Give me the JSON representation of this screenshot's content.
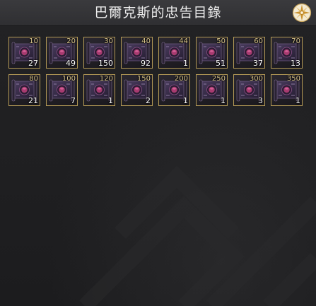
{
  "window": {
    "title": "巴爾克斯的忠告目錄",
    "emblem_icon": "compass-star-icon"
  },
  "colors": {
    "slot_border": "#b49a56",
    "tier_text": "#d8c48a",
    "qty_text": "#ffffff",
    "scroll_body": "#3a2f4a",
    "scroll_seal": "#b03a6e"
  },
  "items": [
    {
      "tier": "10",
      "qty": "27",
      "icon": "scroll-icon"
    },
    {
      "tier": "20",
      "qty": "49",
      "icon": "scroll-icon"
    },
    {
      "tier": "30",
      "qty": "150",
      "icon": "scroll-icon"
    },
    {
      "tier": "40",
      "qty": "92",
      "icon": "scroll-icon"
    },
    {
      "tier": "44",
      "qty": "1",
      "icon": "scroll-icon"
    },
    {
      "tier": "50",
      "qty": "51",
      "icon": "scroll-icon"
    },
    {
      "tier": "60",
      "qty": "37",
      "icon": "scroll-icon"
    },
    {
      "tier": "70",
      "qty": "13",
      "icon": "scroll-icon"
    },
    {
      "tier": "80",
      "qty": "21",
      "icon": "scroll-icon"
    },
    {
      "tier": "100",
      "qty": "7",
      "icon": "scroll-icon"
    },
    {
      "tier": "120",
      "qty": "1",
      "icon": "scroll-icon"
    },
    {
      "tier": "150",
      "qty": "2",
      "icon": "scroll-icon"
    },
    {
      "tier": "200",
      "qty": "1",
      "icon": "scroll-icon"
    },
    {
      "tier": "250",
      "qty": "1",
      "icon": "scroll-icon"
    },
    {
      "tier": "300",
      "qty": "3",
      "icon": "scroll-icon"
    },
    {
      "tier": "350",
      "qty": "1",
      "icon": "scroll-icon"
    }
  ]
}
